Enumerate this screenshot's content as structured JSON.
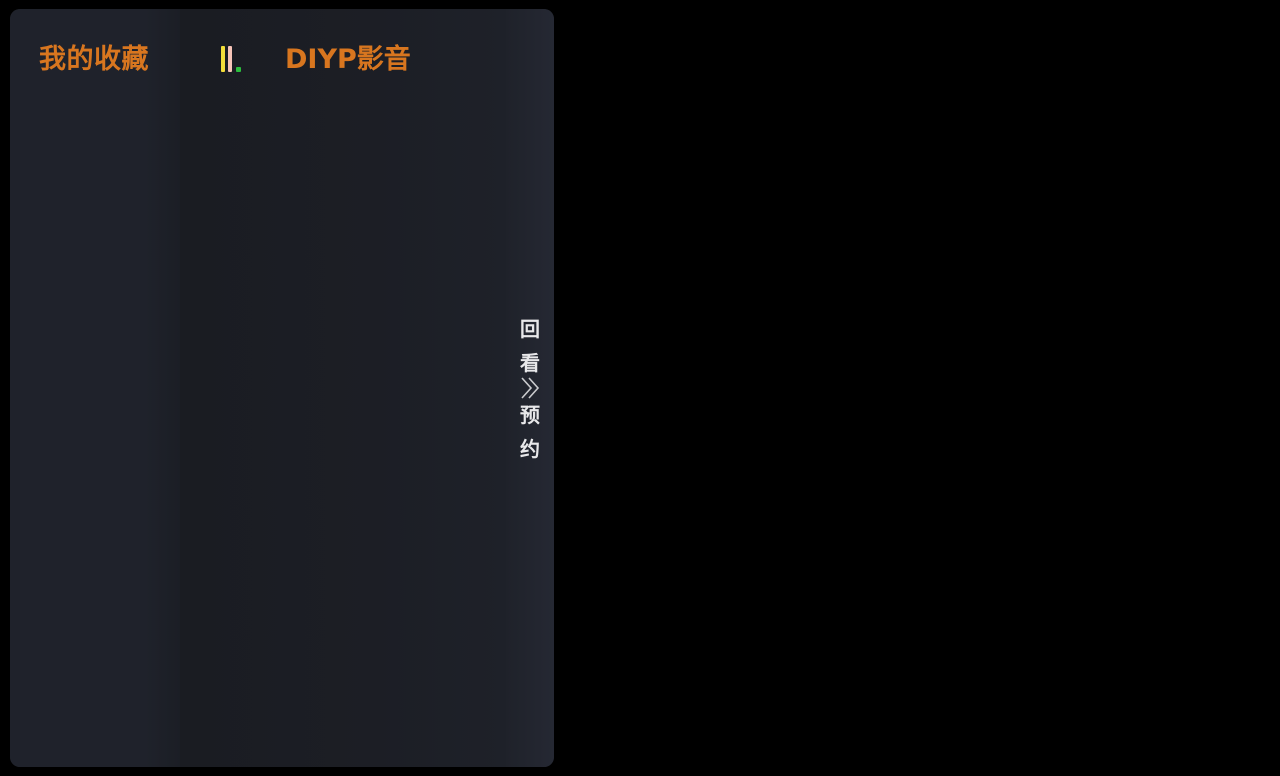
{
  "panel": {
    "favorites_label": "我的收藏",
    "source_label": "DIYP影音",
    "side_menu": {
      "replay_chars": [
        "回",
        "看"
      ],
      "booking_chars": [
        "预",
        "约"
      ],
      "toggle_icon": "chevron-double-right-icon"
    }
  },
  "colors": {
    "accent": "#d8761f",
    "signal_yellow": "#f2dd3a",
    "signal_pink": "#f6c4b8",
    "signal_green": "#2bbd3d",
    "side_text": "#e8e8ea"
  }
}
